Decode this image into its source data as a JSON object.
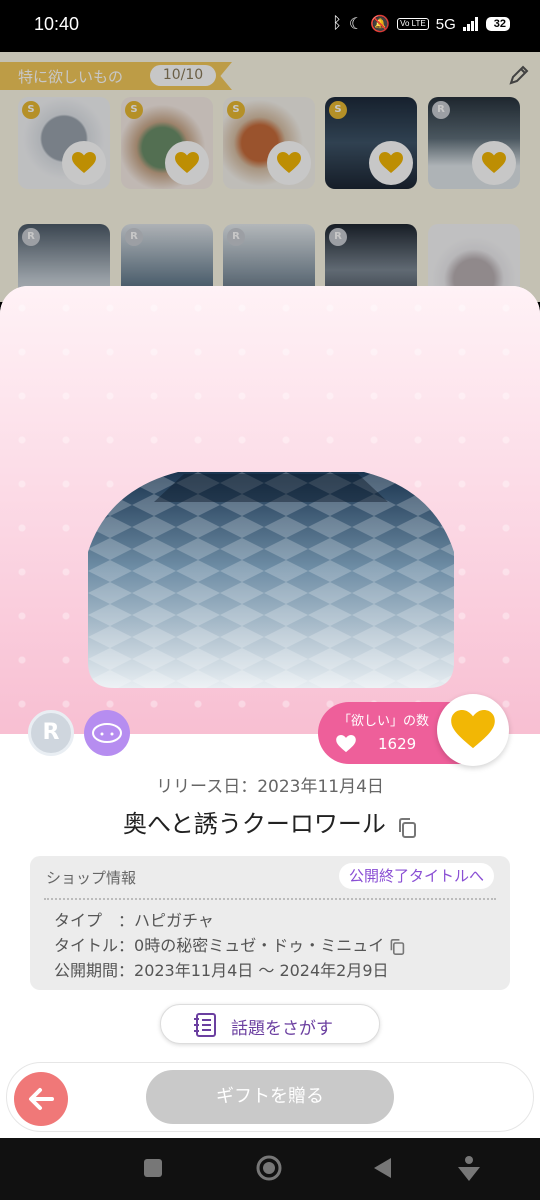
{
  "status_bar": {
    "time": "10:40",
    "network": "5G",
    "volte": "Vo LTE",
    "battery": "32",
    "icons": [
      "bluetooth-icon",
      "moon-icon",
      "mute-icon",
      "signal-icon",
      "battery-icon"
    ]
  },
  "wishlist": {
    "title": "特に欲しいもの",
    "count": "10/10",
    "edit_icon": "pencil-icon",
    "badges_row1": [
      "S",
      "S",
      "S",
      "S",
      "R"
    ],
    "badges_row2": [
      "R",
      "R",
      "R",
      "R",
      ""
    ]
  },
  "item": {
    "rarity": "R",
    "want_label": "「欲しい」の数",
    "want_count": "1629",
    "release": "リリース日：2023年11月4日",
    "name": "奥へと誘うクーロワール"
  },
  "shop": {
    "title": "ショップ情報",
    "link": "公開終了タイトルへ",
    "type_label": "タイプ　：",
    "type_value": "ハピガチャ",
    "title_label": "タイトル：",
    "title_value": "0時の秘密ミュゼ・ドゥ・ミニュイ",
    "period_label": "公開期間：",
    "period_value": "2023年11月4日 ～ 2024年2月9日"
  },
  "actions": {
    "search_topic": "話題をさがす",
    "gift": "ギフトを贈る"
  },
  "colors": {
    "accent_pink": "#ee5f9a",
    "heart_gold": "#f2b705",
    "back_red": "#f07878",
    "link_purple": "#8a4fd4"
  }
}
